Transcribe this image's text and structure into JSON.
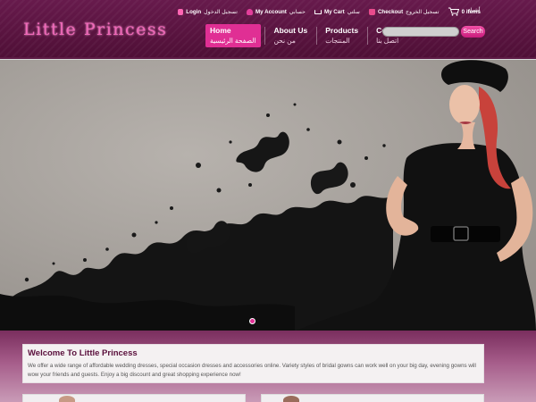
{
  "header": {
    "logo": "Little Princess",
    "utility": {
      "items_count": "0 items",
      "items_ar": "أشياء",
      "checkout_ar": "تسجيل الخروج",
      "checkout": "Checkout",
      "mycart_ar": "سلتي",
      "mycart": "My Cart",
      "account_ar": "حسابي",
      "account": "My Account",
      "login_ar": "تسجيل الدخول",
      "login": "Login"
    },
    "nav": [
      {
        "en": "Home",
        "ar": "الصفحة الرئيسية"
      },
      {
        "en": "About Us",
        "ar": "من نحن"
      },
      {
        "en": "Products",
        "ar": "المنتجات"
      },
      {
        "en": "Contact",
        "ar": "اتصل بنا"
      }
    ],
    "search": {
      "placeholder": "",
      "button": "Search"
    }
  },
  "welcome": {
    "title": "Welcome To Little Princess",
    "text": "We offer a wide range of affordable wedding dresses, special occasion dresses and accessories online. Variety styles of bridal gowns can work well on your big day, evening gowns will wow your friends and guests. Enjoy a big discount and great shopping experience now!"
  },
  "colors": {
    "brand_bg": "#5c1a44",
    "accent": "#e02f94",
    "logo_pink": "#f069b9"
  }
}
